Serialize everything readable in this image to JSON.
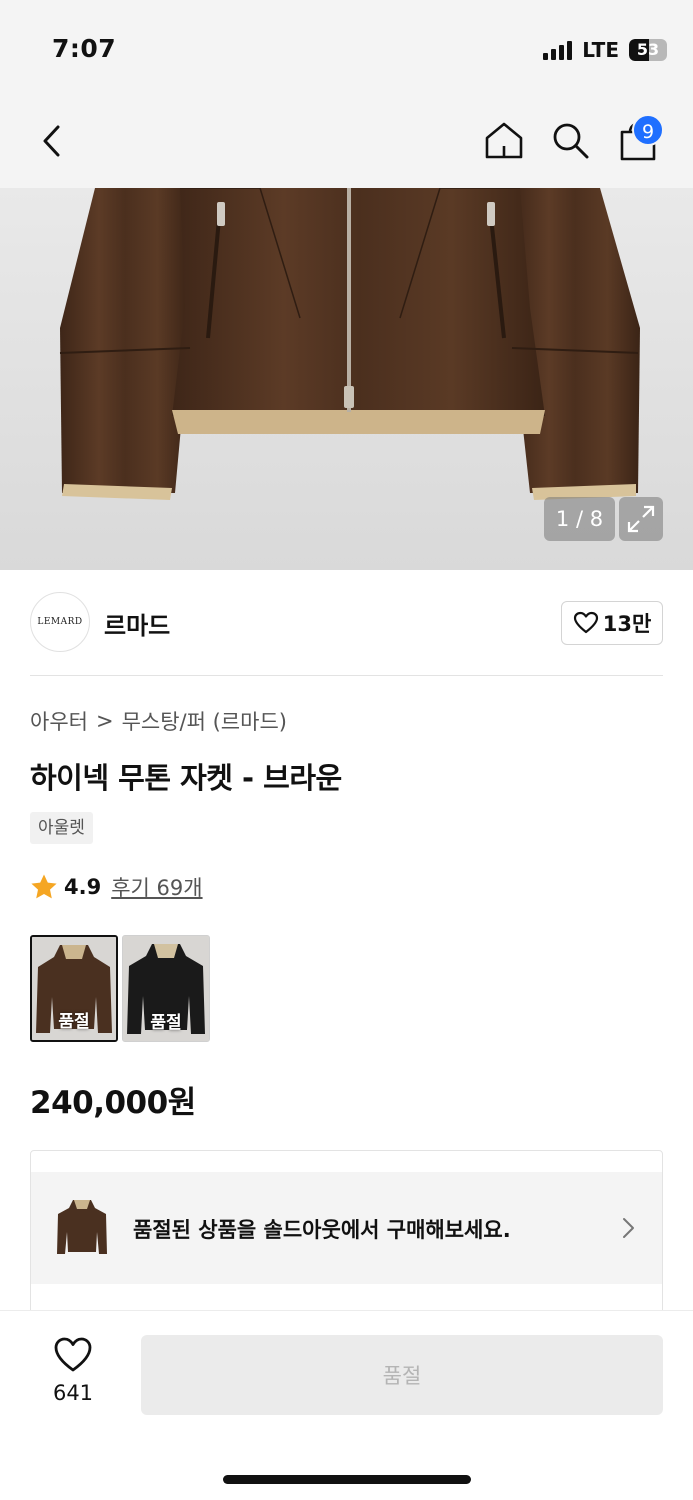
{
  "status_bar": {
    "time": "7:07",
    "network": "LTE",
    "battery": "53",
    "battery_level": 0.53
  },
  "nav": {
    "back_icon": "chevron-left-icon",
    "home_icon": "home-icon",
    "search_icon": "search-icon",
    "cart_icon": "shopping-bag-icon",
    "cart_count": "9"
  },
  "gallery": {
    "counter": "1 / 8",
    "expand_icon": "expand-icon"
  },
  "brand": {
    "logo_text": "LEMARD",
    "name": "르마드",
    "likes": "13만"
  },
  "breadcrumb": {
    "category": "아우터",
    "separator": ">",
    "subcategory": "무스탕/퍼 (르마드)"
  },
  "product": {
    "title": "하이넥 무톤 자켓 - 브라운",
    "tag": "아울렛",
    "rating": "4.9",
    "reviews": "후기 69개",
    "price": "240,000원"
  },
  "swatches": [
    {
      "label": "품절",
      "color": "#4a3020"
    },
    {
      "label": "품절",
      "color": "#1a1a1a"
    }
  ],
  "soldout_banner": {
    "text": "품절된 상품을 솔드아웃에서 구매해보세요."
  },
  "bottom_bar": {
    "wish_count": "641",
    "cta_label": "품절"
  },
  "colors": {
    "accent": "#1f6fff",
    "star": "#f5a623",
    "leather": "#4a3020"
  }
}
